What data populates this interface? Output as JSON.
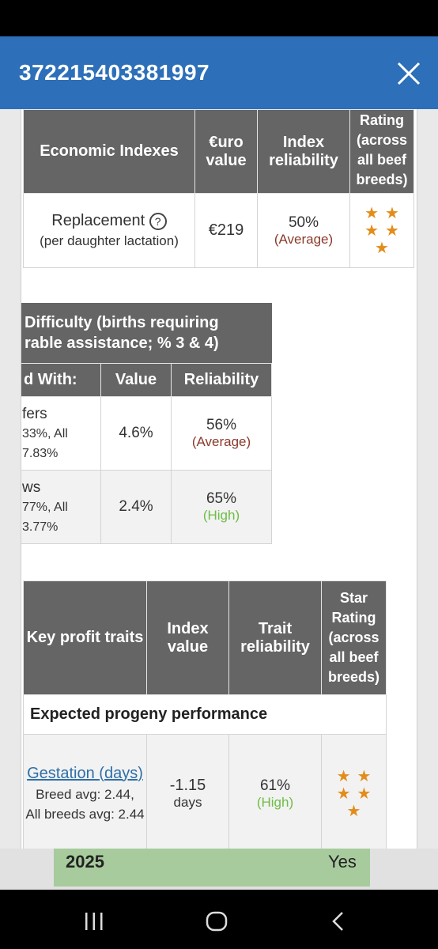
{
  "header": {
    "title": "372215403381997"
  },
  "econ": {
    "headers": [
      "Economic Indexes",
      "€uro value",
      "Index reliability",
      "Rating (across all beef breeds)"
    ],
    "row": {
      "trait": "Replacement",
      "sub": "(per daughter lactation)",
      "value": "€219",
      "reliability": "50%",
      "reliability_label": "(Average)",
      "stars": 5
    }
  },
  "calving": {
    "title_l1": "Difficulty (births requiring",
    "title_l2": "rable assistance; % 3 & 4)",
    "headers": [
      "d With:",
      "Value",
      "Reliability"
    ],
    "rows": [
      {
        "l1": "fers",
        "l2": "33%, All",
        "l3": "7.83%",
        "value": "4.6%",
        "rel": "56%",
        "rel_label": "(Average)"
      },
      {
        "l1": "ws",
        "l2": "77%, All",
        "l3": "3.77%",
        "value": "2.4%",
        "rel": "65%",
        "rel_label": "(High)"
      }
    ]
  },
  "keyprofit": {
    "headers": [
      "Key profit traits",
      "Index value",
      "Trait reliability",
      "Star Rating (across all beef breeds)"
    ],
    "section": "Expected progeny performance",
    "row": {
      "link": "Gestation (days)",
      "breed_avg": "Breed avg: 2.44,",
      "all_avg": "All breeds avg: 2.44",
      "value": "-1.15",
      "unit": "days",
      "rel": "61%",
      "rel_label": "(High)",
      "stars": 5
    }
  },
  "strip": {
    "year": "2025",
    "yes": "Yes"
  },
  "colors": {
    "header": "#2d6fb8",
    "table_header": "#656565",
    "star": "#e28d1b",
    "average": "#8b3a2b",
    "high": "#6dbd45"
  }
}
